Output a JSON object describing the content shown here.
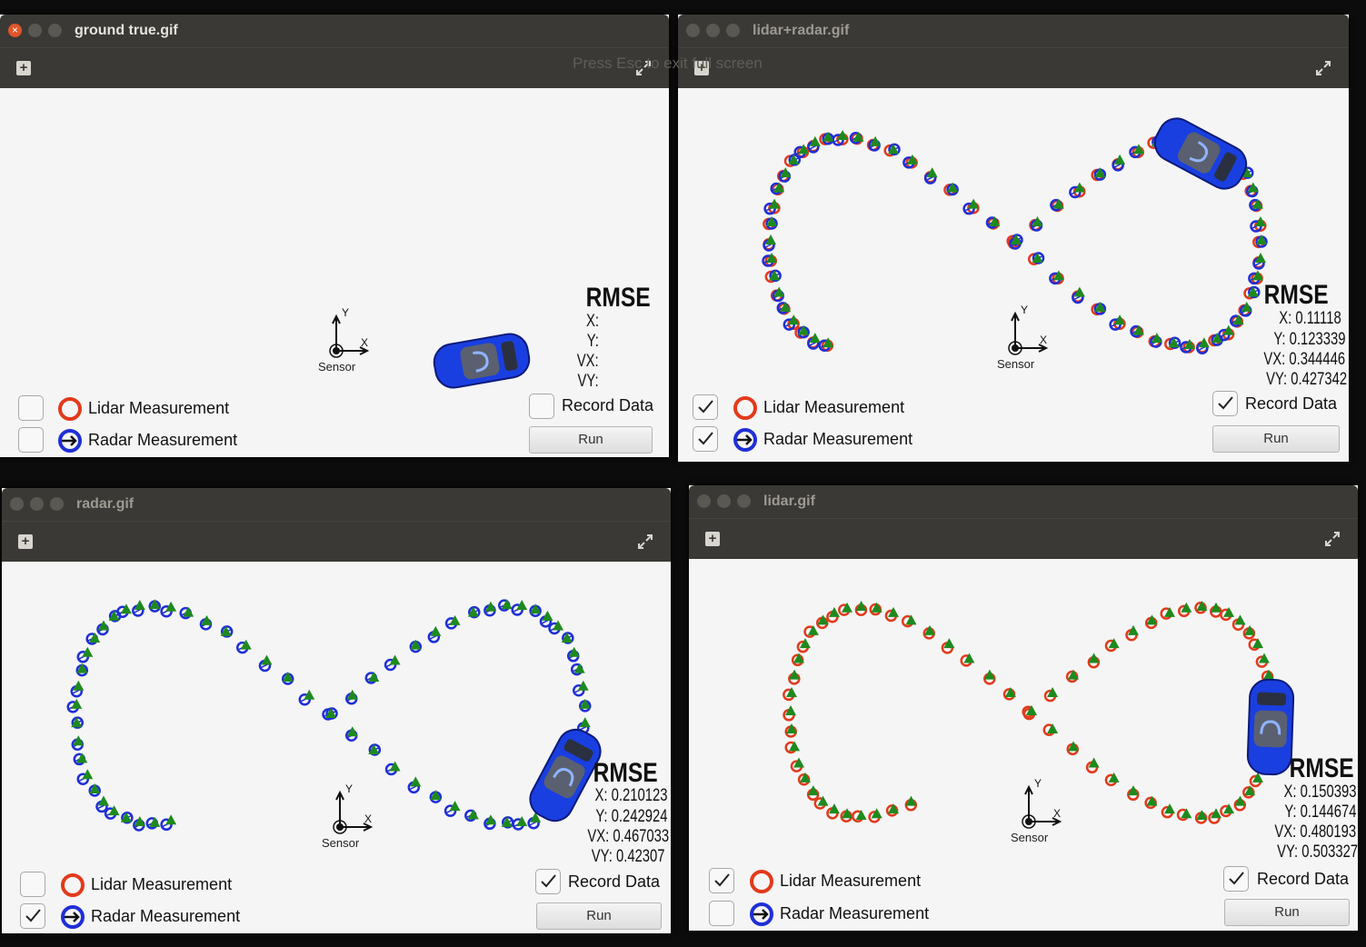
{
  "windows": [
    {
      "id": "w1",
      "title": "ground true.gif",
      "active": true,
      "rmse": {
        "title": "RMSE",
        "x": "X:",
        "y": "Y:",
        "vx": "VX:",
        "vy": "VY:"
      },
      "lidar_label": "Lidar Measurement",
      "radar_label": "Radar Measurement",
      "lidar_checked": false,
      "radar_checked": false,
      "record_checked": false,
      "record_label": "Record Data",
      "run_label": "Run",
      "sensor_label": "Sensor",
      "axis_x": "X",
      "axis_y": "Y"
    },
    {
      "id": "w2",
      "title": "lidar+radar.gif",
      "active": false,
      "rmse": {
        "title": "RMSE",
        "x": "X: 0.11118",
        "y": "Y: 0.123339",
        "vx": "VX: 0.344446",
        "vy": "VY: 0.427342"
      },
      "lidar_label": "Lidar Measurement",
      "radar_label": "Radar Measurement",
      "lidar_checked": true,
      "radar_checked": true,
      "record_checked": true,
      "record_label": "Record Data",
      "run_label": "Run",
      "sensor_label": "Sensor",
      "axis_x": "X",
      "axis_y": "Y"
    },
    {
      "id": "w3",
      "title": "radar.gif",
      "active": false,
      "rmse": {
        "title": "RMSE",
        "x": "X: 0.210123",
        "y": "Y: 0.242924",
        "vx": "VX: 0.467033",
        "vy": "VY: 0.42307"
      },
      "lidar_label": "Lidar Measurement",
      "radar_label": "Radar Measurement",
      "lidar_checked": false,
      "radar_checked": true,
      "record_checked": true,
      "record_label": "Record Data",
      "run_label": "Run",
      "sensor_label": "Sensor",
      "axis_x": "X",
      "axis_y": "Y"
    },
    {
      "id": "w4",
      "title": "lidar.gif",
      "active": false,
      "rmse": {
        "title": "RMSE",
        "x": "X: 0.150393",
        "y": "Y: 0.144674",
        "vx": "VX: 0.480193",
        "vy": "VY: 0.503327"
      },
      "lidar_label": "Lidar Measurement",
      "radar_label": "Radar Measurement",
      "lidar_checked": true,
      "radar_checked": false,
      "record_checked": true,
      "record_label": "Record Data",
      "run_label": "Run",
      "sensor_label": "Sensor",
      "axis_x": "X",
      "axis_y": "Y"
    }
  ],
  "fullscreen_hint": "Press Esc to exit full screen",
  "colors": {
    "lidar": "#e23a1c",
    "radar": "#1f2fd6",
    "estimate": "#1e8a1e",
    "car": "#1a3fe0"
  }
}
